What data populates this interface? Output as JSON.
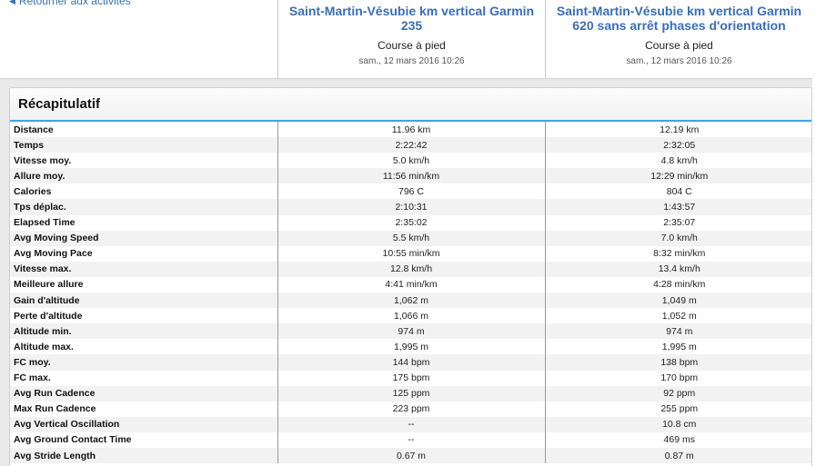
{
  "nav": {
    "back_label": "Retourner aux activités"
  },
  "activities": [
    {
      "title": "Saint-Martin-Vésubie km vertical Garmin 235",
      "type": "Course à pied",
      "date": "sam., 12 mars 2016 10:26"
    },
    {
      "title": "Saint-Martin-Vésubie km vertical Garmin 620 sans arrêt phases d'orientation",
      "type": "Course à pied",
      "date": "sam., 12 mars 2016 10:26"
    }
  ],
  "summary": {
    "title": "Récapitulatif",
    "rows": [
      {
        "label": "Distance",
        "a": "11.96 km",
        "b": "12.19 km"
      },
      {
        "label": "Temps",
        "a": "2:22:42",
        "b": "2:32:05"
      },
      {
        "label": "Vitesse moy.",
        "a": "5.0 km/h",
        "b": "4.8 km/h"
      },
      {
        "label": "Allure moy.",
        "a": "11:56 min/km",
        "b": "12:29 min/km"
      },
      {
        "label": "Calories",
        "a": "796 C",
        "b": "804 C"
      },
      {
        "label": "Tps déplac.",
        "a": "2:10:31",
        "b": "1:43:57"
      },
      {
        "label": "Elapsed Time",
        "a": "2:35:02",
        "b": "2:35:07"
      },
      {
        "label": "Avg Moving Speed",
        "a": "5.5 km/h",
        "b": "7.0 km/h"
      },
      {
        "label": "Avg Moving Pace",
        "a": "10:55 min/km",
        "b": "8:32 min/km"
      },
      {
        "label": "Vitesse max.",
        "a": "12.8 km/h",
        "b": "13.4 km/h"
      },
      {
        "label": "Meilleure allure",
        "a": "4:41 min/km",
        "b": "4:28 min/km"
      },
      {
        "label": "Gain d'altitude",
        "a": "1,062 m",
        "b": "1,049 m"
      },
      {
        "label": "Perte d'altitude",
        "a": "1,066 m",
        "b": "1,052 m"
      },
      {
        "label": "Altitude min.",
        "a": "974 m",
        "b": "974 m"
      },
      {
        "label": "Altitude max.",
        "a": "1,995 m",
        "b": "1,995 m"
      },
      {
        "label": "FC moy.",
        "a": "144 bpm",
        "b": "138 bpm"
      },
      {
        "label": "FC max.",
        "a": "175 bpm",
        "b": "170 bpm"
      },
      {
        "label": "Avg Run Cadence",
        "a": "125 ppm",
        "b": "92 ppm"
      },
      {
        "label": "Max Run Cadence",
        "a": "223 ppm",
        "b": "255 ppm"
      },
      {
        "label": "Avg Vertical Oscillation",
        "a": "--",
        "b": "10.8 cm"
      },
      {
        "label": "Avg Ground Contact Time",
        "a": "--",
        "b": "469 ms"
      },
      {
        "label": "Avg Stride Length",
        "a": "0.67 m",
        "b": "0.87 m"
      }
    ]
  },
  "colors": {
    "link": "#3a6eb5",
    "accent": "#3fa4e0",
    "panel_bg": "#e9e9e9"
  },
  "icons": {
    "back": "chevron-left-icon"
  }
}
